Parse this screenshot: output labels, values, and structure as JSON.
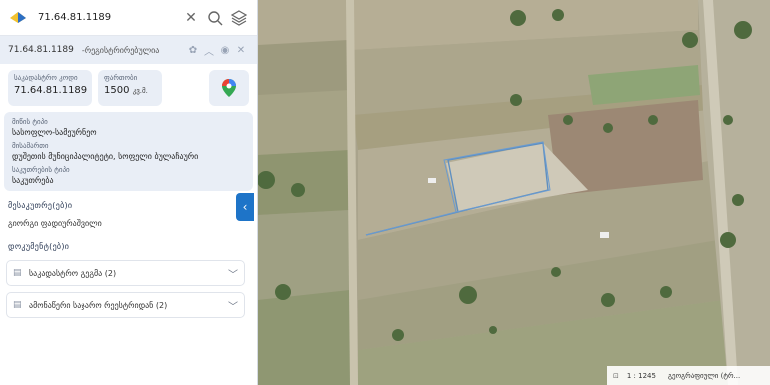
{
  "search": {
    "value": "71.64.81.1189"
  },
  "title_bar": {
    "cadastral": "71.64.81.1189",
    "registered": "-რეგისტრირებულია"
  },
  "cards": {
    "cadastral_label": "საკადასტრო კოდი",
    "cadastral_value": "71.64.81.1189",
    "area_label": "ფართობი",
    "area_value": "1500",
    "area_unit": "კვ.მ."
  },
  "info": {
    "land_type_label": "მიწის ტიპი",
    "land_type_value": "სასოფლო-სამეურნეო",
    "address_label": "მისამართი",
    "address_value": "დუშეთის მუნიციპალიტეტი, სოფელი ბულაჩაური",
    "ownership_label": "საკუთრების ტიპი",
    "ownership_value": "საკუთრება"
  },
  "owners": {
    "title": "მესაკუთრე(ებ)ი",
    "name": "გიორგი ფადიურაშვილი"
  },
  "documents": {
    "title": "დოკუმენტ(ებ)ი",
    "items": [
      {
        "label": "საკადასტრო გეგმა (2)"
      },
      {
        "label": "ამონაწერი საჯარო რეესტრიდან (2)"
      }
    ]
  },
  "map": {
    "scale": "1 : 1245",
    "layer": "გეოგრაფიული (ტრ..."
  },
  "colors": {
    "accent": "#1e74c8",
    "panel": "#e9eef6"
  }
}
